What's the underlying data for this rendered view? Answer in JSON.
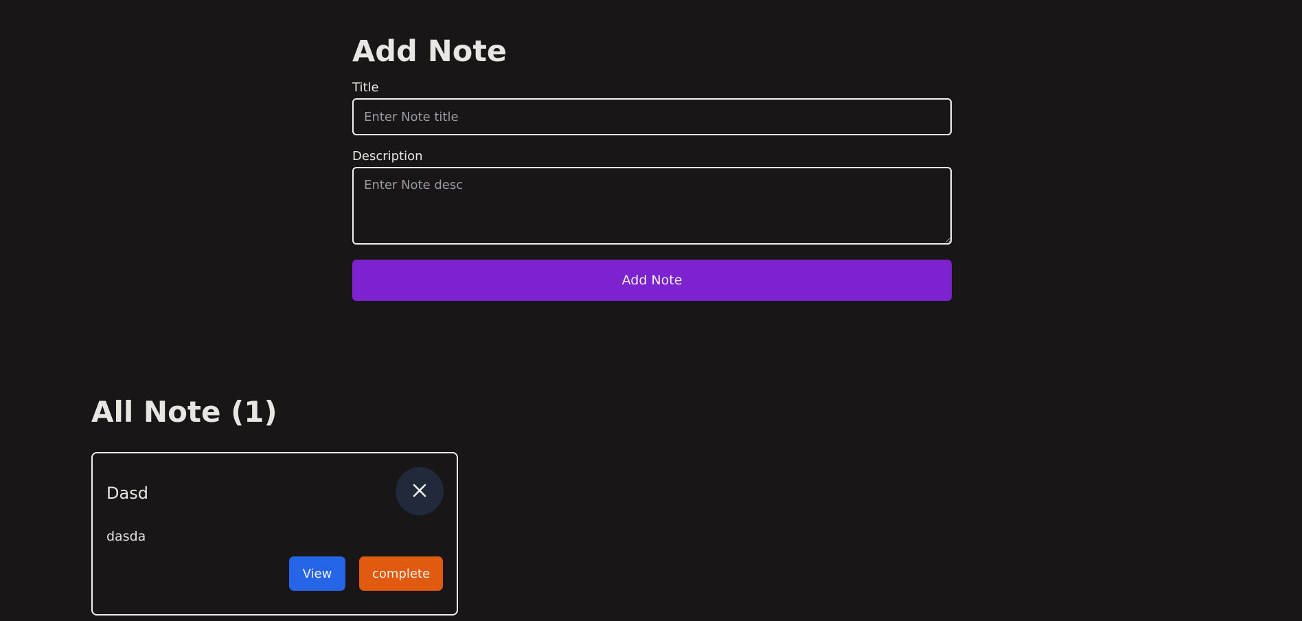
{
  "form": {
    "heading": "Add Note",
    "title_label": "Title",
    "title_placeholder": "Enter Note title",
    "title_value": "",
    "description_label": "Description",
    "description_placeholder": "Enter Note desc",
    "description_value": "",
    "submit_label": "Add Note"
  },
  "notes": {
    "heading": "All Note (1)",
    "items": [
      {
        "title": "Dasd",
        "description": "dasda",
        "delete_icon": "close-icon",
        "view_label": "View",
        "complete_label": "complete"
      }
    ]
  },
  "colors": {
    "background": "#181617",
    "submit_button": "#7c22cf",
    "view_button": "#2665e8",
    "complete_button": "#e05a10",
    "delete_button": "#202a3b"
  }
}
